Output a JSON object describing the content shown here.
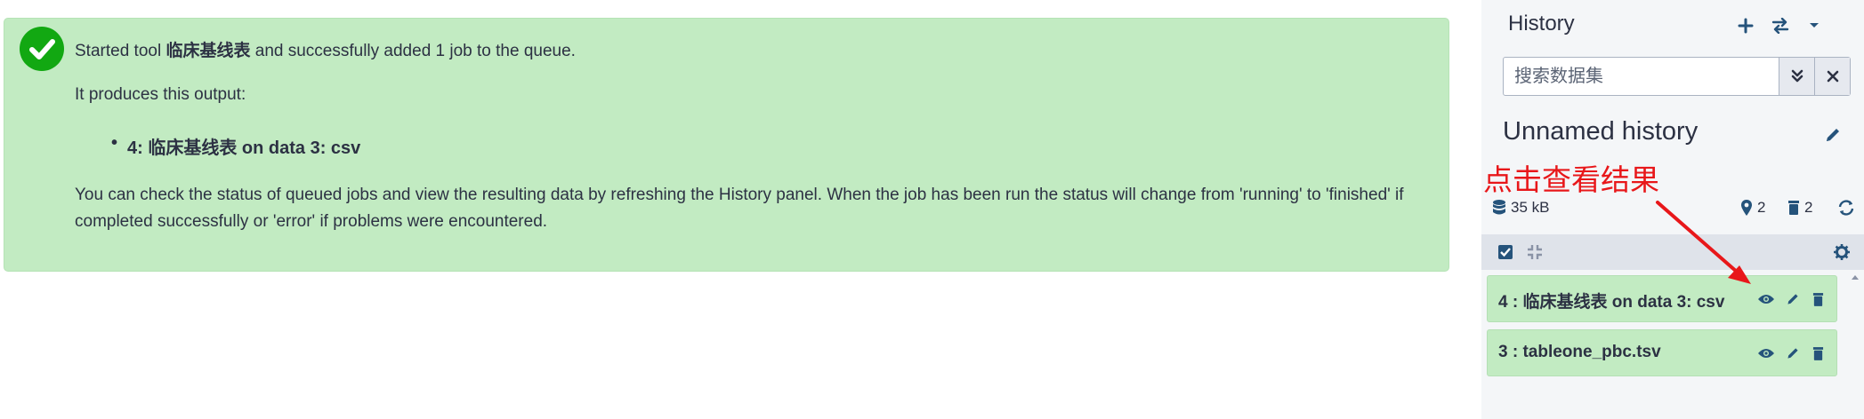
{
  "message": {
    "started_prefix": "Started tool ",
    "tool_name": "临床基线表",
    "started_suffix": " and successfully added 1 job to the queue.",
    "produces": "It produces this output:",
    "output_item": "4: 临床基线表 on data 3: csv",
    "status_note": "You can check the status of queued jobs and view the resulting data by refreshing the History panel. When the job has been run the status will change from 'running' to 'finished' if completed successfully or 'error' if problems were encountered."
  },
  "history": {
    "title": "History",
    "search_placeholder": "搜索数据集",
    "name": "Unnamed history",
    "size": "35 kB",
    "shown_count": "2",
    "deleted_count": "2",
    "items": [
      {
        "hid_title": "4 : 临床基线表 on data 3: csv"
      },
      {
        "hid_title": "3 : tableone_pbc.tsv"
      }
    ]
  },
  "annotation": "点击查看结果",
  "colors": {
    "success_bg": "#c2ebc2",
    "success_icon": "#12a812",
    "panel_bg": "#f4f6f8",
    "icon": "#25537b",
    "annotation": "#e8171a"
  }
}
